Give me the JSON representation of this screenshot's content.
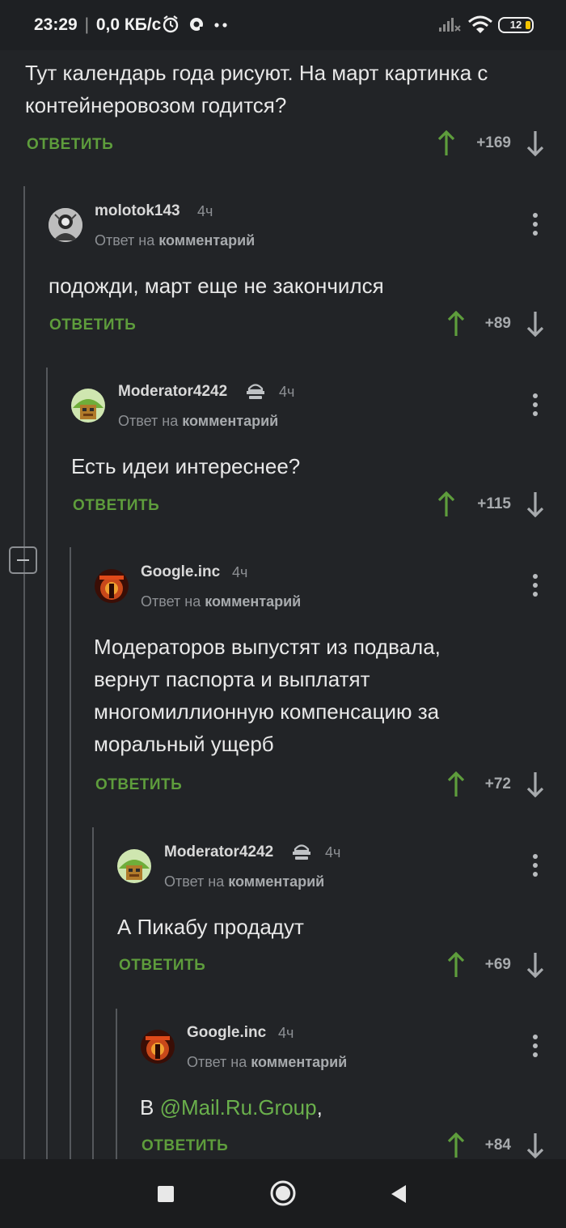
{
  "status_bar": {
    "time": "23:29",
    "network_speed": "0,0 КБ/с",
    "battery": "12",
    "icons": [
      "alarm-icon",
      "app-notification-icon",
      "more-dots-icon",
      "signal-icon",
      "wifi-icon",
      "battery-icon"
    ]
  },
  "thread": {
    "top_comment": {
      "text": "Тут календарь года рисуют. На март картинка с контейнеровозом годится?",
      "reply_label": "ОТВЕТИТЬ",
      "score": "+169"
    },
    "comments": [
      {
        "author": "molotok143",
        "time": "4ч",
        "moderator": false,
        "reply_prefix": "Ответ на",
        "reply_target": "комментарий",
        "text": "подожди, март еще не закончился",
        "reply_label": "ОТВЕТИТЬ",
        "score": "+89"
      },
      {
        "author": "Moderator4242",
        "time": "4ч",
        "moderator": true,
        "reply_prefix": "Ответ на",
        "reply_target": "комментарий",
        "text": "Есть идеи интереснее?",
        "reply_label": "ОТВЕТИТЬ",
        "score": "+115"
      },
      {
        "author": "Google.inc",
        "time": "4ч",
        "moderator": false,
        "reply_prefix": "Ответ на",
        "reply_target": "комментарий",
        "text": "Модераторов выпустят из подвала, вернут паспорта и выплатят многомиллионную компенсацию за моральный ущерб",
        "reply_label": "ОТВЕТИТЬ",
        "score": "+72"
      },
      {
        "author": "Moderator4242",
        "time": "4ч",
        "moderator": true,
        "reply_prefix": "Ответ на",
        "reply_target": "комментарий",
        "text": "А Пикабу продадут",
        "reply_label": "ОТВЕТИТЬ",
        "score": "+69"
      },
      {
        "author": "Google.inc",
        "time": "4ч",
        "moderator": false,
        "reply_prefix": "Ответ на",
        "reply_target": "комментарий",
        "text_prefix": "В ",
        "text_link": "@Mail.Ru.Group",
        "text_suffix": ",",
        "reply_label": "ОТВЕТИТЬ",
        "score": "+84"
      }
    ]
  },
  "nav_bar": {
    "buttons": [
      "recent-apps-button",
      "home-button",
      "back-button"
    ]
  },
  "colors": {
    "background": "#222427",
    "accent_green": "#5e9d3c",
    "link_green": "#6ab04c",
    "muted_text": "#8d9094"
  }
}
